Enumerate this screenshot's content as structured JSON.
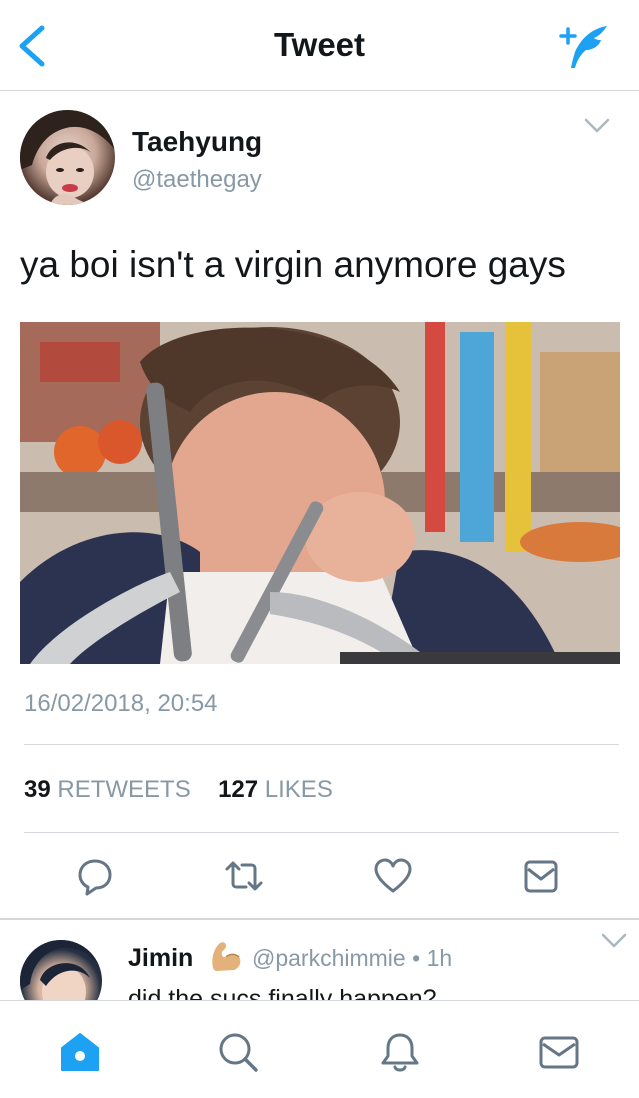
{
  "header": {
    "title": "Tweet",
    "back_icon": "chevron-left-icon",
    "compose_icon": "compose-tweet-icon",
    "accent": "#1da1f2"
  },
  "tweet": {
    "author_name": "Taehyung",
    "author_handle": "@taethegay",
    "text": "ya boi isn't a virgin anymore gays",
    "timestamp": "16/02/2018, 20:54",
    "retweet_count": "39",
    "retweet_label": "RETWEETS",
    "like_count": "127",
    "like_label": "LIKES",
    "actions": [
      "reply-icon",
      "retweet-icon",
      "like-icon",
      "direct-message-icon"
    ]
  },
  "reply": {
    "author_name": "Jimin",
    "emoji": "muscle-emoji",
    "author_handle": "@parkchimmie",
    "separator": "•",
    "time": "1h",
    "text": "did the sucs finally happen?"
  },
  "tabbar": {
    "items": [
      "home-icon",
      "search-icon",
      "notifications-icon",
      "messages-icon"
    ],
    "active": "home-icon"
  }
}
